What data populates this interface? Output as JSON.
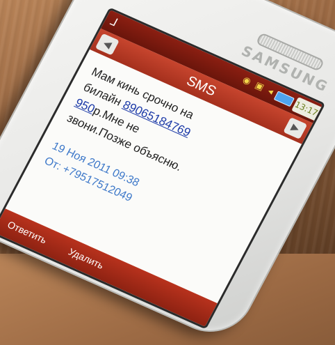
{
  "phone": {
    "brand": "SAMSUNG"
  },
  "status_bar": {
    "app_icon": "signal-icon",
    "icons": "◉ ▣ ◂",
    "clock": "13:17"
  },
  "screen": {
    "title": "SMS",
    "prev_label": "◀",
    "next_label": "▶"
  },
  "message": {
    "line1": "Мам кинь срочно на",
    "line2_prefix": "билайн ",
    "phone_number": "89065184769",
    "line3_amount": "950",
    "line3_rest": "р.Мне не",
    "line4": "звони.Позже объясню."
  },
  "meta": {
    "datetime": "19 Ноя 2011 09:38",
    "sender": "От: +79517512049"
  },
  "softkeys": {
    "reply": "Ответить",
    "delete": "Удалить"
  }
}
